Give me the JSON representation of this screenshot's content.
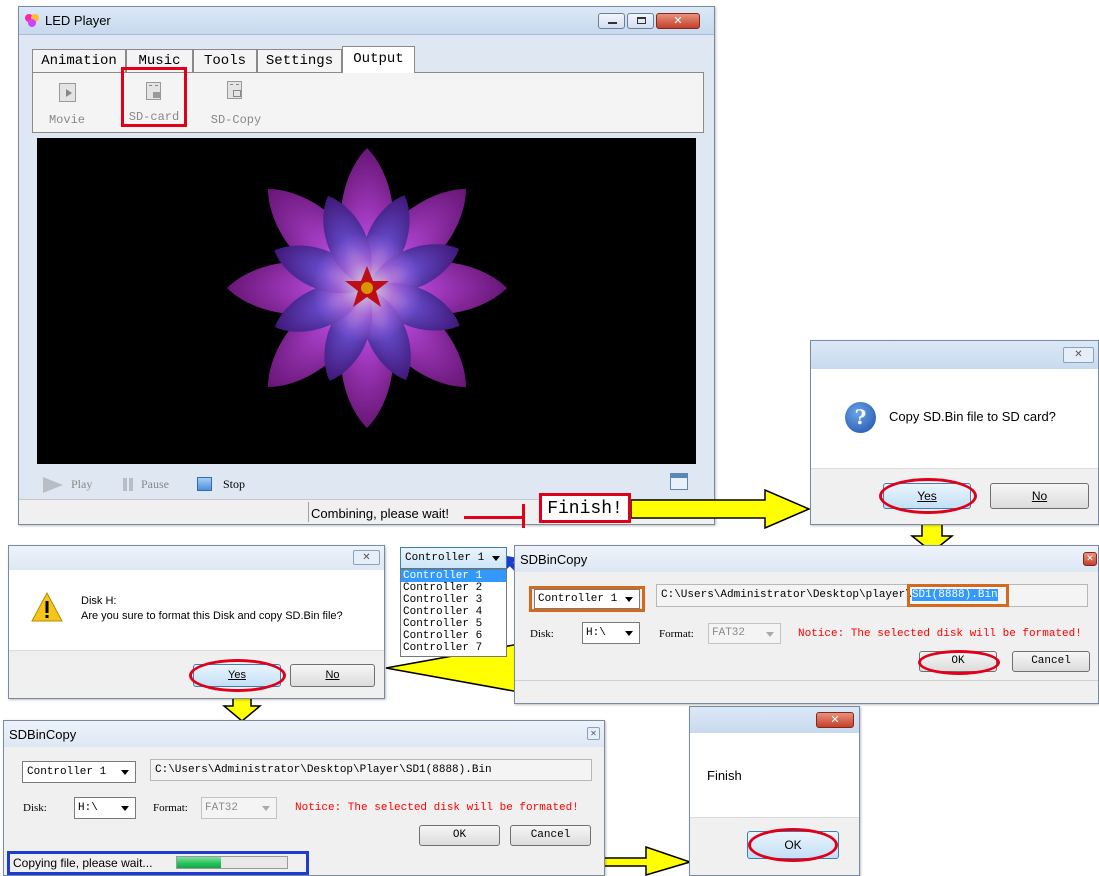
{
  "main_window": {
    "title": "LED Player",
    "tabs": [
      "Animation",
      "Music",
      "Tools",
      "Settings",
      "Output"
    ],
    "active_tab": "Output",
    "toolbar": [
      {
        "label": "Movie",
        "icon": "movie-icon"
      },
      {
        "label": "SD-card",
        "icon": "sd-card-icon"
      },
      {
        "label": "SD-Copy",
        "icon": "sd-copy-icon"
      }
    ],
    "controls": {
      "play": "Play",
      "pause": "Pause",
      "stop": "Stop"
    },
    "status": "Combining, please wait!"
  },
  "finish_callout": "Finish!",
  "confirm_copy_dialog": {
    "message": "Copy SD.Bin file to SD card?",
    "yes": "Yes",
    "no": "No",
    "icon": "question-icon"
  },
  "format_dialog": {
    "line1": "Disk H:",
    "line2": "Are you sure to format this Disk and copy SD.Bin file?",
    "yes": "Yes",
    "no": "No",
    "icon": "warning-icon"
  },
  "controller_dropdown": {
    "selected": "Controller 1",
    "options": [
      "Controller 1",
      "Controller 2",
      "Controller 3",
      "Controller 4",
      "Controller 5",
      "Controller 6",
      "Controller 7"
    ]
  },
  "sdbincopy_dialog": {
    "title": "SDBinCopy",
    "controller": "Controller 1",
    "path_prefix": "C:\\Users\\Administrator\\Desktop\\player\\",
    "path_file": "SD1(8888).Bin",
    "disk_label": "Disk:",
    "disk_value": "H:\\",
    "format_label": "Format:",
    "format_value": "FAT32",
    "notice": "Notice: The selected disk will be formated!",
    "ok": "OK",
    "cancel": "Cancel"
  },
  "sdbincopy_progress_dialog": {
    "title": "SDBinCopy",
    "controller": "Controller 1",
    "path": "C:\\Users\\Administrator\\Desktop\\Player\\SD1(8888).Bin",
    "disk_label": "Disk:",
    "disk_value": "H:\\",
    "format_label": "Format:",
    "format_value": "FAT32",
    "notice": "Notice: The selected disk will be formated!",
    "ok": "OK",
    "cancel": "Cancel",
    "status": "Copying file, please wait...",
    "progress_fraction": 0.4
  },
  "finish_dialog": {
    "message": "Finish",
    "ok": "OK"
  },
  "colors": {
    "highlight_red": "#e0001a",
    "highlight_orange": "#d2691e",
    "highlight_blue": "#1e3ccf",
    "arrow_yellow": "#ffff00",
    "progress_green": "#22c25a",
    "notice_red": "#ff0000"
  }
}
